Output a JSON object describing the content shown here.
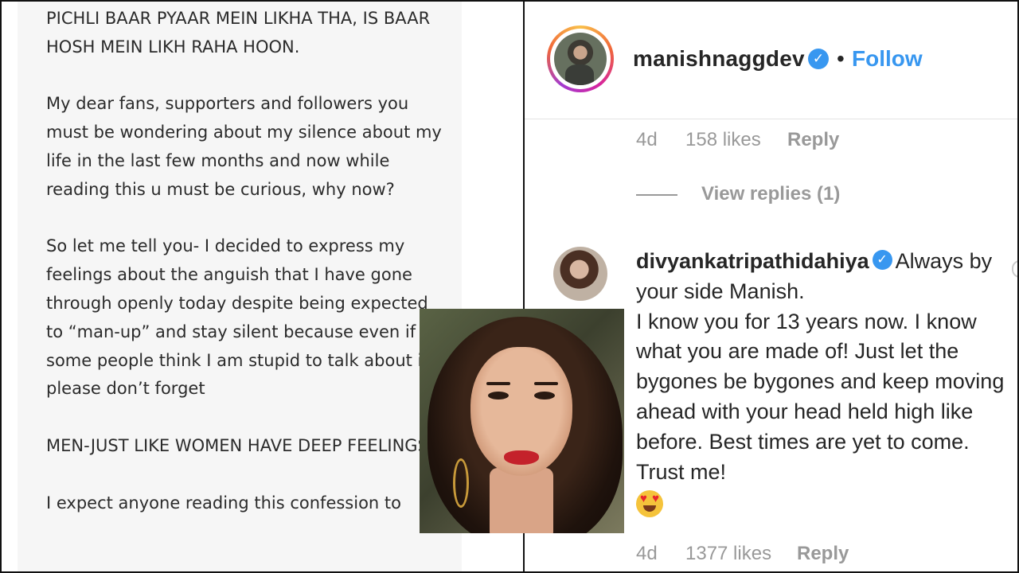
{
  "note": {
    "paragraphs": [
      "PICHLI BAAR PYAAR MEIN LIKHA THA, IS BAAR HOSH MEIN LIKH RAHA HOON.",
      "My dear fans, supporters and followers you must be wondering about my silence about my life in the last few months and now while reading this u must be curious, why now?",
      "So let me tell you- I decided to express my feelings about the anguish that I have gone through openly today despite being expected to “man-up” and stay silent because even if some people think I am stupid to talk about it please don’t forget",
      "MEN-JUST LIKE WOMEN HAVE DEEP FEELINGS.",
      "I expect anyone reading this confession to"
    ]
  },
  "post_header": {
    "username": "manishnaggdev",
    "verified_icon": "verified-badge-icon",
    "separator": "•",
    "follow_label": "Follow"
  },
  "first_comment_meta": {
    "time": "4d",
    "likes": "158 likes",
    "reply_label": "Reply"
  },
  "view_replies": "View replies (1)",
  "second_comment": {
    "username": "divyankatripathidahiya",
    "text_lead": "Always by your side Manish.",
    "text_body": "I know you for 13 years now. I know what you are made of! Just let the bygones be bygones and keep moving ahead with your head held high like before. Best times are yet to come. Trust me!",
    "emoji": "heart-eyes-emoji",
    "time": "4d",
    "likes": "1377 likes",
    "reply_label": "Reply"
  },
  "colors": {
    "link_blue": "#3897f0",
    "meta_gray": "#999999",
    "text_dark": "#262626",
    "note_bg": "#f6f6f6",
    "lipstick_red": "#c4222b"
  }
}
